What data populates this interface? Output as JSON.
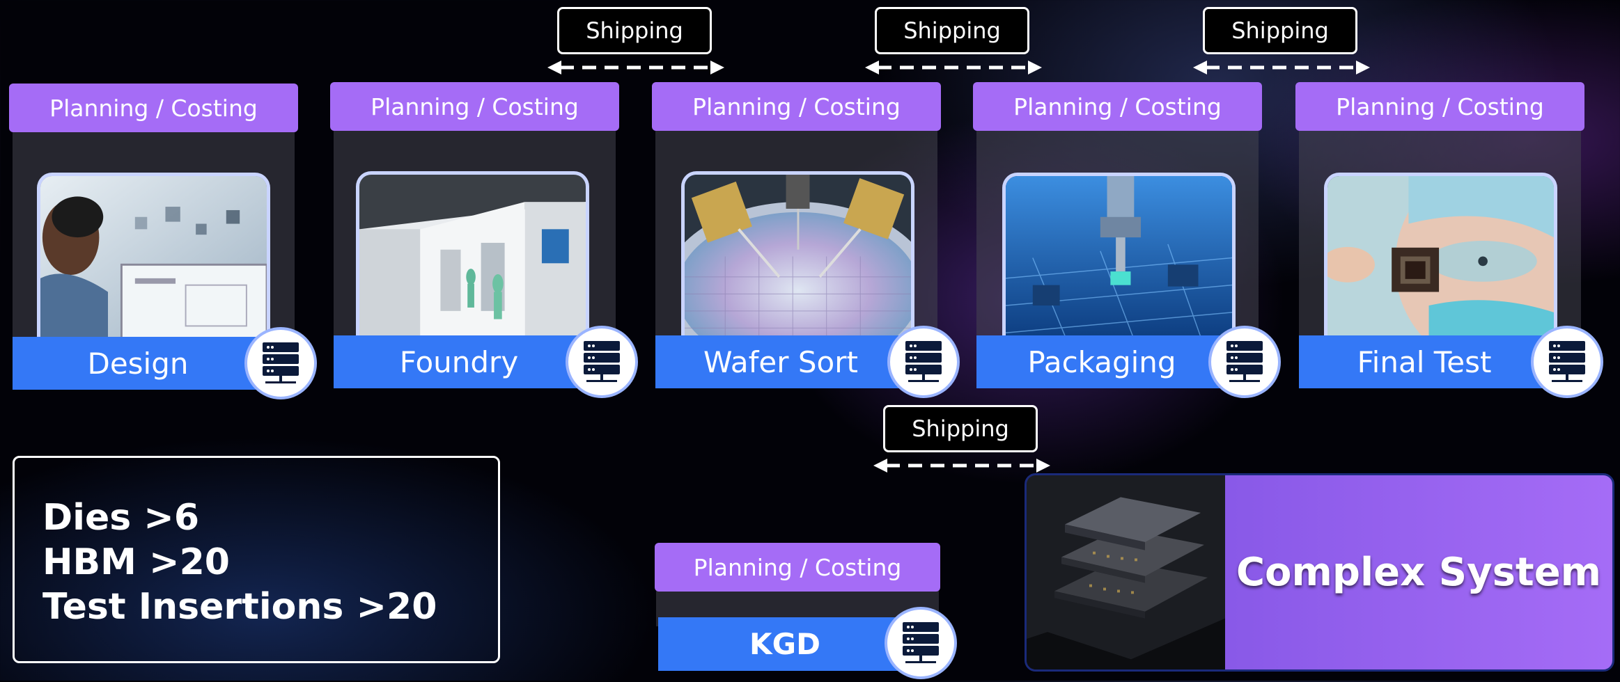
{
  "stages": [
    {
      "plan_label": "Planning / Costing",
      "name": "Design",
      "photo": "designer-at-monitor"
    },
    {
      "plan_label": "Planning / Costing",
      "name": "Foundry",
      "photo": "cleanroom-fab"
    },
    {
      "plan_label": "Planning / Costing",
      "name": "Wafer Sort",
      "photo": "wafer-probe-station"
    },
    {
      "plan_label": "Planning / Costing",
      "name": "Packaging",
      "photo": "package-assembly-robot"
    },
    {
      "plan_label": "Planning / Costing",
      "name": "Final Test",
      "photo": "technician-holding-chip"
    }
  ],
  "shipping": [
    {
      "label": "Shipping"
    },
    {
      "label": "Shipping"
    },
    {
      "label": "Shipping"
    },
    {
      "label": "Shipping"
    }
  ],
  "stats": [
    "Dies >6",
    "HBM >20",
    "Test Insertions >20"
  ],
  "kgd": {
    "plan_label": "Planning / Costing",
    "name": "KGD"
  },
  "complex_system": {
    "title": "Complex System",
    "photo": "stacked-chip-layers"
  },
  "icons": {
    "stage_icon": "server-icon"
  },
  "colors": {
    "plan": "#a56cf6",
    "label_bar": "#3478f6",
    "accent_gradient_end": "#a56cf6"
  }
}
